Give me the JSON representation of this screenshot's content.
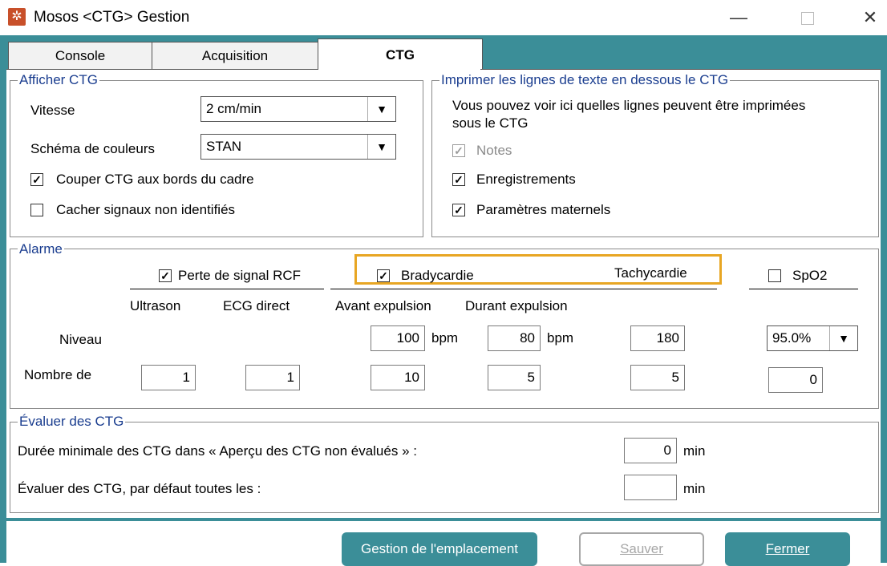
{
  "window": {
    "title": "Mosos <CTG> Gestion"
  },
  "tabs": [
    {
      "label": "Console"
    },
    {
      "label": "Acquisition"
    },
    {
      "label": "CTG"
    }
  ],
  "afficher": {
    "legend": "Afficher CTG",
    "vitesse_label": "Vitesse",
    "vitesse_value": "2 cm/min",
    "schema_label": "Schéma de couleurs",
    "schema_value": "STAN",
    "couper_label": "Couper CTG aux bords du cadre",
    "couper_checked": true,
    "cacher_label": "Cacher signaux non identifiés",
    "cacher_checked": false
  },
  "imprimer": {
    "legend": "Imprimer les lignes de texte en dessous le CTG",
    "desc_line1": "Vous pouvez voir ici quelles lignes peuvent être imprimées",
    "desc_line2": "sous le CTG",
    "notes_label": "Notes",
    "enreg_label": "Enregistrements",
    "param_label": "Paramètres maternels"
  },
  "alarme": {
    "legend": "Alarme",
    "perte_label": "Perte de signal RCF",
    "brady_label": "Bradycardie",
    "tachy_label": "Tachycardie",
    "spo2_label": "SpO2",
    "ultrason": "Ultrason",
    "ecg_direct": "ECG direct",
    "avant": "Avant expulsion",
    "durant": "Durant expulsion",
    "niveau_label": "Niveau",
    "nombre_label": "Nombre de",
    "bpm": "bpm",
    "niveau_avant": "100",
    "niveau_durant": "80",
    "niveau_tachy": "180",
    "niveau_spo2": "95.0%",
    "nombre_ultrason": "1",
    "nombre_ecg": "1",
    "nombre_avant": "10",
    "nombre_durant": "5",
    "nombre_tachy": "5",
    "nombre_spo2": "0"
  },
  "evaluer": {
    "legend": "Évaluer des CTG",
    "duree_label": "Durée minimale des CTG dans « Aperçu des CTG non évalués » :",
    "duree_value": "0",
    "defaut_label": "Évaluer des CTG, par défaut toutes les :",
    "defaut_value": "",
    "min": "min"
  },
  "buttons": {
    "gestion": "Gestion de l'emplacement",
    "sauver": "Sauver",
    "fermer": "Fermer"
  },
  "colors": {
    "accent": "#3b8e98",
    "legend": "#1a3d8f",
    "highlight": "#e8a623"
  }
}
